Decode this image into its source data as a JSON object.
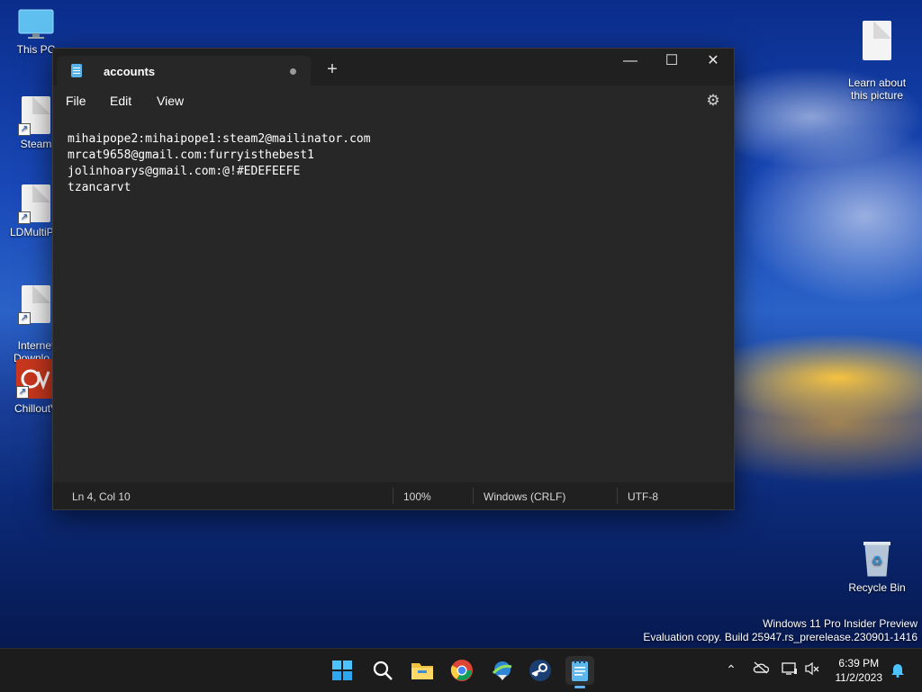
{
  "desktop": {
    "icons": [
      {
        "label": "This PC"
      },
      {
        "label": "Steam"
      },
      {
        "label": "LDMultiPla"
      },
      {
        "label": "Internet\nDownlo..."
      },
      {
        "label": "ChilloutV"
      },
      {
        "label": "Learn about\nthis picture"
      },
      {
        "label": "Recycle Bin"
      }
    ],
    "watermark": {
      "line1": "Windows 11 Pro Insider Preview",
      "line2": "Evaluation copy. Build 25947.rs_prerelease.230901-1416"
    }
  },
  "notepad": {
    "tab_title": "accounts",
    "new_tab": "+",
    "controls": {
      "minimize": "—",
      "maximize": "☐",
      "close": "✕"
    },
    "menu": [
      "File",
      "Edit",
      "View"
    ],
    "lines": [
      "mihaipope2:mihaipope1:steam2@mailinator.com",
      "mrcat9658@gmail.com:furryisthebest1",
      "jolinhoarys@gmail.com:@!#EDEFEEFE",
      "tzancarvt"
    ],
    "status": {
      "position": "Ln 4, Col 10",
      "zoom": "100%",
      "line_ending": "Windows (CRLF)",
      "encoding": "UTF-8"
    }
  },
  "taskbar": {
    "apps": [
      "start-icon",
      "search-icon",
      "file-explorer-icon",
      "chrome-icon",
      "internet-download-manager-icon",
      "steam-icon",
      "notepad-icon"
    ],
    "tray": [
      "chevron-up-icon",
      "onedrive-icon",
      "network-icon",
      "volume-muted-icon"
    ],
    "clock": {
      "time": "6:39 PM",
      "date": "11/2/2023"
    }
  },
  "colors": {
    "accent": "#5fb2f2",
    "window_bg": "#272727",
    "titlebar_bg": "#202020"
  }
}
